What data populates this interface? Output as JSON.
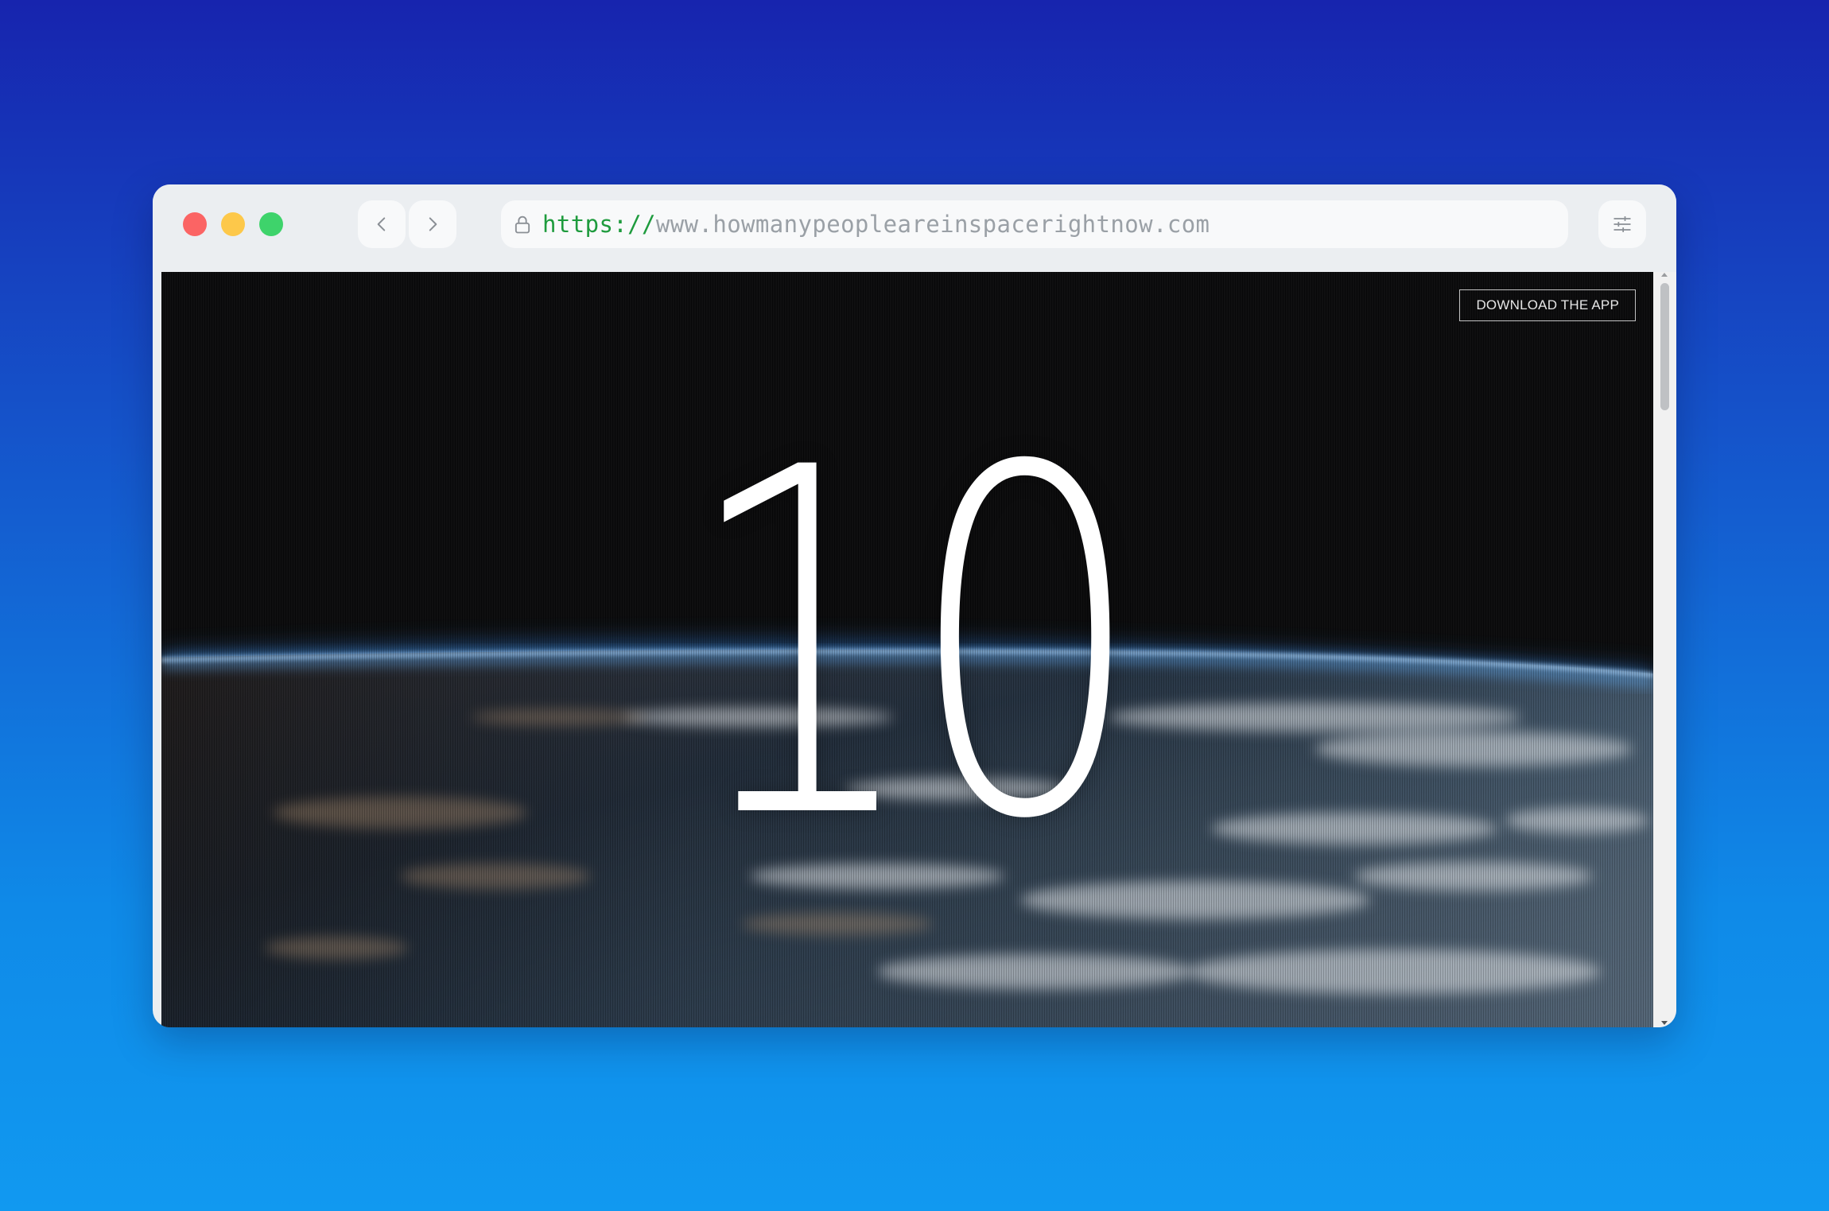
{
  "browser": {
    "url_scheme": "https://",
    "url_host": "www.howmanypeopleareinspacerightnow.com",
    "controls": {
      "back_icon": "chevron-left-icon",
      "forward_icon": "chevron-right-icon",
      "lock_icon": "lock-icon",
      "settings_icon": "sliders-icon"
    },
    "traffic_lights": {
      "close_color": "#fb6464",
      "minimize_color": "#fdc84a",
      "maximize_color": "#3ed36b"
    }
  },
  "page": {
    "download_button_label": "DOWNLOAD THE APP",
    "people_in_space_count": "10"
  },
  "colors": {
    "background_top": "#1724ae",
    "background_bottom": "#1199f0",
    "url_scheme": "#1e9b3d",
    "url_host": "#9aa0a6"
  }
}
